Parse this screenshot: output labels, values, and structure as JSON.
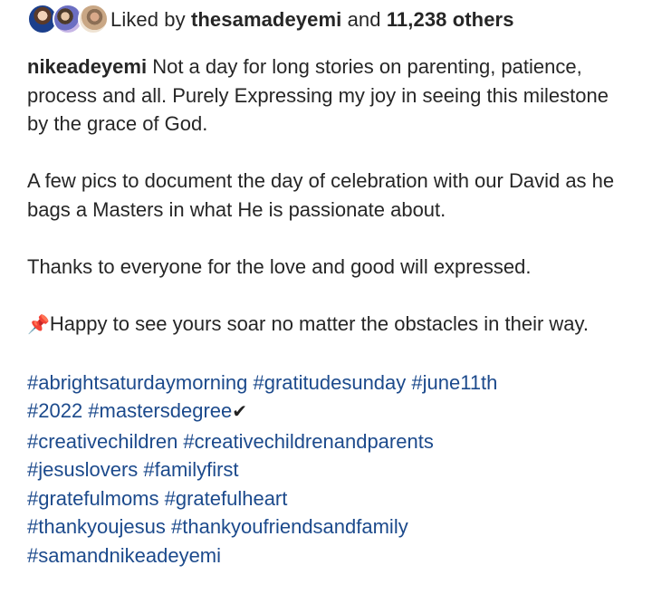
{
  "likes": {
    "prefix": "Liked by",
    "user": "thesamadeyemi",
    "middle": "and",
    "count": "11,238 others"
  },
  "caption": {
    "username": "nikeadeyemi",
    "para1": "Not a day for long stories on parenting, patience, process and all. Purely Expressing my joy in seeing this milestone by the grace of God.",
    "para2": "A few pics to document the day of celebration with our David as he bags a Masters in what He is passionate about.",
    "para3": "Thanks to everyone for the love and good will expressed.",
    "pin_icon": "pushpin-icon",
    "para4": "Happy to see yours soar no matter the obstacles in their way."
  },
  "hashtags": {
    "line1": "#abrightsaturdaymorning #gratitudesunday #june11th",
    "line2": "#2022 #mastersdegree",
    "check_icon": "checkmark-icon",
    "line3": "#creativechildren #creativechildrenandparents",
    "line4": "#jesuslovers #familyfirst",
    "line5": "#gratefulmoms #gratefulheart",
    "line6": "#thankyoujesus #thankyoufriendsandfamily",
    "line7": "#samandnikeadeyemi"
  },
  "colors": {
    "text": "#262626",
    "hashtag": "#1c4a8c"
  }
}
